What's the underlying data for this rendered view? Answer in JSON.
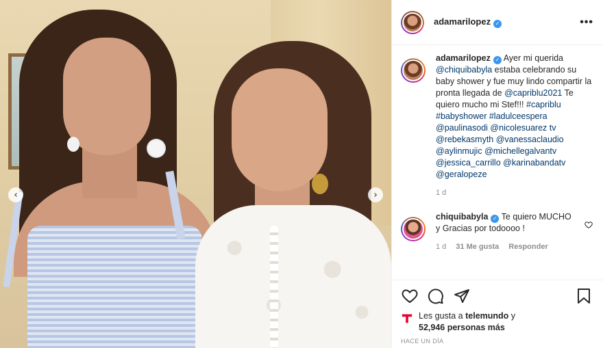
{
  "post": {
    "author": "adamarilopez",
    "caption": {
      "username": "adamarilopez",
      "segments": [
        {
          "t": "Ayer mi querida ",
          "link": false
        },
        {
          "t": "@chiquibabyla",
          "link": true
        },
        {
          "t": " estaba celebrando su baby shower y fue muy lindo compartir la pronta llegada de ",
          "link": false
        },
        {
          "t": "@capriblu2021",
          "link": true
        },
        {
          "t": " Te quiero mucho mi Stef!!! ",
          "link": false
        },
        {
          "t": "#capriblu",
          "link": true
        },
        {
          "t": " ",
          "link": false
        },
        {
          "t": "#babyshower",
          "link": true
        },
        {
          "t": " ",
          "link": false
        },
        {
          "t": "#ladulceespera",
          "link": true
        },
        {
          "t": " ",
          "link": false
        },
        {
          "t": "@paulinasodi",
          "link": true
        },
        {
          "t": " ",
          "link": false
        },
        {
          "t": "@nicolesuarez tv",
          "link": true
        },
        {
          "t": " ",
          "link": false
        },
        {
          "t": "@rebekasmyth",
          "link": true
        },
        {
          "t": " ",
          "link": false
        },
        {
          "t": "@vanessaclaudio",
          "link": true
        },
        {
          "t": " ",
          "link": false
        },
        {
          "t": "@aylinmujic",
          "link": true
        },
        {
          "t": " ",
          "link": false
        },
        {
          "t": "@michellegalvantv",
          "link": true
        },
        {
          "t": " ",
          "link": false
        },
        {
          "t": "@jessica_carrillo",
          "link": true
        },
        {
          "t": " ",
          "link": false
        },
        {
          "t": "@karinabandatv",
          "link": true
        },
        {
          "t": " ",
          "link": false
        },
        {
          "t": "@geralopeze",
          "link": true
        }
      ],
      "age": "1 d"
    },
    "reply": {
      "username": "chiquibabyla",
      "text": "Te quiero MUCHO y Gracias por todoooo !",
      "age": "1 d",
      "likes": "31 Me gusta",
      "reply_label": "Responder"
    },
    "likes": {
      "prefix": "Les gusta a ",
      "user": "telemundo",
      "middle": " y",
      "count": "52,946 personas más"
    },
    "time_ago": "HACE UN DÍA",
    "more_label": "•••",
    "carousel_prev": "‹",
    "carousel_next": "›",
    "verified_mark": "✓",
    "colors": {
      "link": "#00376b",
      "verified": "#3897f0",
      "secondary_text": "#8e8e8e",
      "telemundo_red": "#e4032e"
    }
  }
}
